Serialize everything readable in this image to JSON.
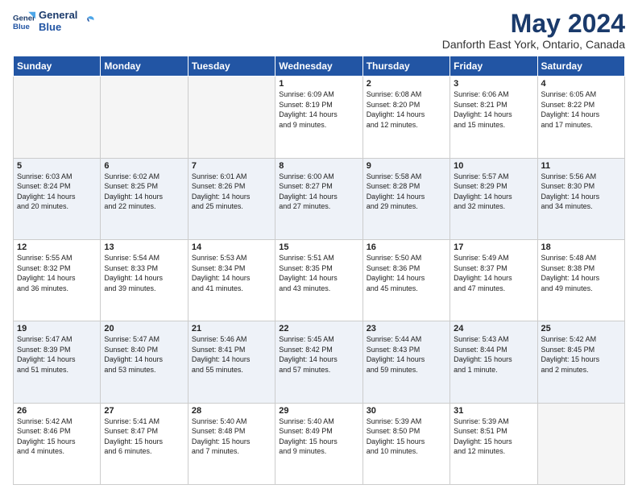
{
  "logo": {
    "line1": "General",
    "line2": "Blue"
  },
  "title": "May 2024",
  "subtitle": "Danforth East York, Ontario, Canada",
  "header_days": [
    "Sunday",
    "Monday",
    "Tuesday",
    "Wednesday",
    "Thursday",
    "Friday",
    "Saturday"
  ],
  "weeks": [
    [
      {
        "day": "",
        "info": ""
      },
      {
        "day": "",
        "info": ""
      },
      {
        "day": "",
        "info": ""
      },
      {
        "day": "1",
        "info": "Sunrise: 6:09 AM\nSunset: 8:19 PM\nDaylight: 14 hours\nand 9 minutes."
      },
      {
        "day": "2",
        "info": "Sunrise: 6:08 AM\nSunset: 8:20 PM\nDaylight: 14 hours\nand 12 minutes."
      },
      {
        "day": "3",
        "info": "Sunrise: 6:06 AM\nSunset: 8:21 PM\nDaylight: 14 hours\nand 15 minutes."
      },
      {
        "day": "4",
        "info": "Sunrise: 6:05 AM\nSunset: 8:22 PM\nDaylight: 14 hours\nand 17 minutes."
      }
    ],
    [
      {
        "day": "5",
        "info": "Sunrise: 6:03 AM\nSunset: 8:24 PM\nDaylight: 14 hours\nand 20 minutes."
      },
      {
        "day": "6",
        "info": "Sunrise: 6:02 AM\nSunset: 8:25 PM\nDaylight: 14 hours\nand 22 minutes."
      },
      {
        "day": "7",
        "info": "Sunrise: 6:01 AM\nSunset: 8:26 PM\nDaylight: 14 hours\nand 25 minutes."
      },
      {
        "day": "8",
        "info": "Sunrise: 6:00 AM\nSunset: 8:27 PM\nDaylight: 14 hours\nand 27 minutes."
      },
      {
        "day": "9",
        "info": "Sunrise: 5:58 AM\nSunset: 8:28 PM\nDaylight: 14 hours\nand 29 minutes."
      },
      {
        "day": "10",
        "info": "Sunrise: 5:57 AM\nSunset: 8:29 PM\nDaylight: 14 hours\nand 32 minutes."
      },
      {
        "day": "11",
        "info": "Sunrise: 5:56 AM\nSunset: 8:30 PM\nDaylight: 14 hours\nand 34 minutes."
      }
    ],
    [
      {
        "day": "12",
        "info": "Sunrise: 5:55 AM\nSunset: 8:32 PM\nDaylight: 14 hours\nand 36 minutes."
      },
      {
        "day": "13",
        "info": "Sunrise: 5:54 AM\nSunset: 8:33 PM\nDaylight: 14 hours\nand 39 minutes."
      },
      {
        "day": "14",
        "info": "Sunrise: 5:53 AM\nSunset: 8:34 PM\nDaylight: 14 hours\nand 41 minutes."
      },
      {
        "day": "15",
        "info": "Sunrise: 5:51 AM\nSunset: 8:35 PM\nDaylight: 14 hours\nand 43 minutes."
      },
      {
        "day": "16",
        "info": "Sunrise: 5:50 AM\nSunset: 8:36 PM\nDaylight: 14 hours\nand 45 minutes."
      },
      {
        "day": "17",
        "info": "Sunrise: 5:49 AM\nSunset: 8:37 PM\nDaylight: 14 hours\nand 47 minutes."
      },
      {
        "day": "18",
        "info": "Sunrise: 5:48 AM\nSunset: 8:38 PM\nDaylight: 14 hours\nand 49 minutes."
      }
    ],
    [
      {
        "day": "19",
        "info": "Sunrise: 5:47 AM\nSunset: 8:39 PM\nDaylight: 14 hours\nand 51 minutes."
      },
      {
        "day": "20",
        "info": "Sunrise: 5:47 AM\nSunset: 8:40 PM\nDaylight: 14 hours\nand 53 minutes."
      },
      {
        "day": "21",
        "info": "Sunrise: 5:46 AM\nSunset: 8:41 PM\nDaylight: 14 hours\nand 55 minutes."
      },
      {
        "day": "22",
        "info": "Sunrise: 5:45 AM\nSunset: 8:42 PM\nDaylight: 14 hours\nand 57 minutes."
      },
      {
        "day": "23",
        "info": "Sunrise: 5:44 AM\nSunset: 8:43 PM\nDaylight: 14 hours\nand 59 minutes."
      },
      {
        "day": "24",
        "info": "Sunrise: 5:43 AM\nSunset: 8:44 PM\nDaylight: 15 hours\nand 1 minute."
      },
      {
        "day": "25",
        "info": "Sunrise: 5:42 AM\nSunset: 8:45 PM\nDaylight: 15 hours\nand 2 minutes."
      }
    ],
    [
      {
        "day": "26",
        "info": "Sunrise: 5:42 AM\nSunset: 8:46 PM\nDaylight: 15 hours\nand 4 minutes."
      },
      {
        "day": "27",
        "info": "Sunrise: 5:41 AM\nSunset: 8:47 PM\nDaylight: 15 hours\nand 6 minutes."
      },
      {
        "day": "28",
        "info": "Sunrise: 5:40 AM\nSunset: 8:48 PM\nDaylight: 15 hours\nand 7 minutes."
      },
      {
        "day": "29",
        "info": "Sunrise: 5:40 AM\nSunset: 8:49 PM\nDaylight: 15 hours\nand 9 minutes."
      },
      {
        "day": "30",
        "info": "Sunrise: 5:39 AM\nSunset: 8:50 PM\nDaylight: 15 hours\nand 10 minutes."
      },
      {
        "day": "31",
        "info": "Sunrise: 5:39 AM\nSunset: 8:51 PM\nDaylight: 15 hours\nand 12 minutes."
      },
      {
        "day": "",
        "info": ""
      }
    ]
  ]
}
